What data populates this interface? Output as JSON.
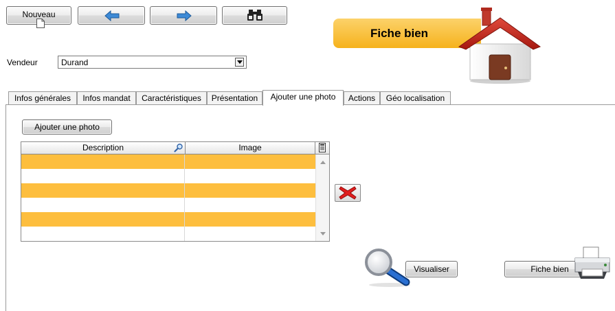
{
  "toolbar": {
    "new_label": "Nouveau",
    "prev_icon": "arrow-left-icon",
    "next_icon": "arrow-right-icon",
    "search_icon": "binoculars-icon"
  },
  "banner": {
    "title": "Fiche bien",
    "icon": "house-icon"
  },
  "vendeur": {
    "label": "Vendeur",
    "value": "Durand"
  },
  "tabs": [
    {
      "label": "Infos générales"
    },
    {
      "label": "Infos mandat"
    },
    {
      "label": "Caractéristiques"
    },
    {
      "label": "Présentation"
    },
    {
      "label": "Ajouter une photo",
      "active": true
    },
    {
      "label": "Actions"
    },
    {
      "label": "Géo localisation"
    }
  ],
  "photo": {
    "add_button": "Ajouter une photo",
    "columns": [
      "Description",
      "Image"
    ],
    "rows": [
      {
        "description": "",
        "image": ""
      },
      {
        "description": "",
        "image": ""
      },
      {
        "description": "",
        "image": ""
      },
      {
        "description": "",
        "image": ""
      },
      {
        "description": "",
        "image": ""
      },
      {
        "description": "",
        "image": ""
      }
    ]
  },
  "actions": {
    "visualiser_label": "Visualiser",
    "fiche_bien_label": "Fiche bien"
  },
  "colors": {
    "accent_orange": "#fdbe3e",
    "banner_orange": "#f6b21c",
    "delete_red": "#e01e1e"
  }
}
